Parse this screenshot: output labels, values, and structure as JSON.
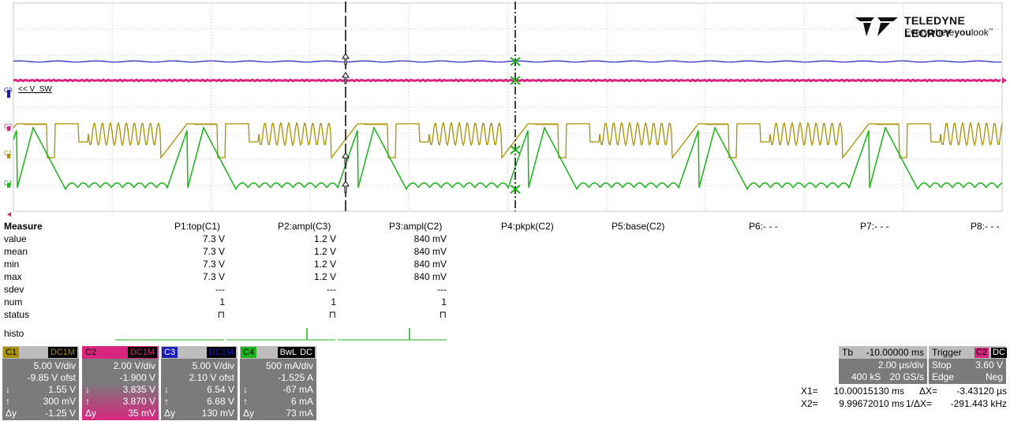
{
  "brand": {
    "name": "TELEDYNE LECROY",
    "tag_pre": "Everywhere",
    "tag_bold": "you",
    "tag_post": "look",
    "tm": "™"
  },
  "trace_labels": {
    "c3_marker": "C3",
    "v_sw": "<< V_SW",
    "c2": "C2",
    "c1": "C1",
    "c4": "C4"
  },
  "colors": {
    "c1": "#a89000",
    "c2": "#d8267e",
    "c3": "#1c1cb8",
    "c4": "#18b418",
    "grid": "#c8c8c8"
  },
  "measure": {
    "title": "Measure",
    "params": [
      "P1:top(C1)",
      "P2:ampl(C3)",
      "P3:ampl(C2)",
      "P4:pkpk(C2)",
      "P5:base(C2)",
      "P6:- - -",
      "P7:- - -",
      "P8:- - -"
    ],
    "rows": [
      {
        "label": "value",
        "v": [
          "7.3 V",
          "1.2 V",
          "840 mV"
        ]
      },
      {
        "label": "mean",
        "v": [
          "7.3 V",
          "1.2 V",
          "840 mV"
        ]
      },
      {
        "label": "min",
        "v": [
          "7.3 V",
          "1.2 V",
          "840 mV"
        ]
      },
      {
        "label": "max",
        "v": [
          "7.3 V",
          "1.2 V",
          "840 mV"
        ]
      },
      {
        "label": "sdev",
        "v": [
          "---",
          "---",
          "---"
        ]
      },
      {
        "label": "num",
        "v": [
          "1",
          "1",
          "1"
        ]
      },
      {
        "label": "status",
        "v": [
          "⊓",
          "⊓",
          "⊓"
        ]
      }
    ],
    "histo_label": "histo"
  },
  "channels": [
    {
      "id": "C1",
      "coupling": "DC1M",
      "vdiv": "5.00 V/div",
      "ofst": "-9.85 V ofst",
      "down": "1.55 V",
      "up": "300 mV",
      "dy": "-1.25 V",
      "arrow_down": "↓",
      "arrow_up": "↑",
      "dy_label": "Δy"
    },
    {
      "id": "C2",
      "coupling": "DC1M",
      "vdiv": "2.00 V/div",
      "ofst": "-1.900 V",
      "down": "3.835 V",
      "up": "3.870 V",
      "dy": "35 mV",
      "arrow_down": "↓",
      "arrow_up": "↑",
      "dy_label": "Δy"
    },
    {
      "id": "C3",
      "coupling": "DC1M",
      "vdiv": "5.00 V/div",
      "ofst": "2.10 V ofst",
      "down": "6.54 V",
      "up": "6.68 V",
      "dy": "130 mV",
      "arrow_down": "↓",
      "arrow_up": "↑",
      "dy_label": "Δy"
    },
    {
      "id": "C4",
      "coupling": "BwL",
      "coupling2": "DC",
      "vdiv": "500 mA/div",
      "ofst": "-1.525 A",
      "down": "-67 mA",
      "up": "6 mA",
      "dy": "73 mA",
      "arrow_down": "↓",
      "arrow_up": "↑",
      "dy_label": "Δy"
    }
  ],
  "timebase": {
    "label": "Tb",
    "delay": "-10.00000 ms",
    "per_div": "2.00 µs/div",
    "samples": "400 kS",
    "rate": "20 GS/s"
  },
  "trigger": {
    "label": "Trigger",
    "source": "C2",
    "coupling": "DC",
    "mode": "Stop",
    "level": "3.60 V",
    "type": "Edge",
    "slope": "Neg"
  },
  "cursors": {
    "x1_label": "X1=",
    "x1": "10.00015130 ms",
    "dx_label": "ΔX=",
    "dx": "-3.43120 µs",
    "x2_label": "X2=",
    "x2": "9.99672010 ms",
    "inv_dx_label": "1/ΔX=",
    "inv_dx": "-291.443 kHz"
  }
}
